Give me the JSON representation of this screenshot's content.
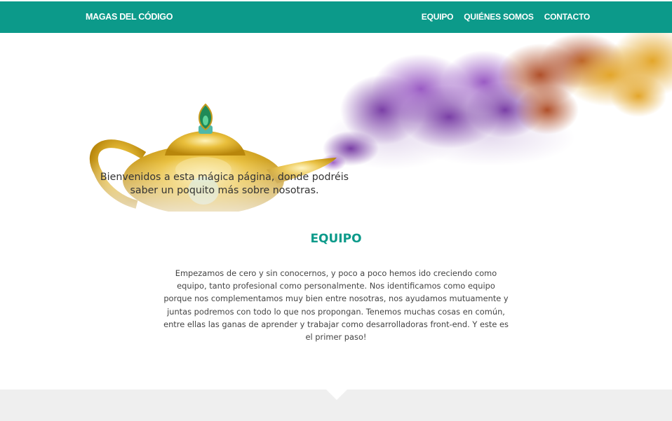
{
  "header": {
    "brand": "MAGAS DEL CÓDIGO",
    "nav": [
      {
        "label": "EQUIPO"
      },
      {
        "label": "QUIÉNES SOMOS"
      },
      {
        "label": "CONTACTO"
      }
    ]
  },
  "hero": {
    "tagline": "Bienvenidos a esta mágica página, donde podréis saber un poquito más sobre nosotras."
  },
  "team": {
    "title": "EQUIPO",
    "body": "Empezamos de cero y sin conocernos, y poco a poco hemos ido creciendo como equipo, tanto profesional como personalmente. Nos identificamos como equipo porque nos complementamos muy bien entre nosotras, nos ayudamos mutuamente y juntas podremos con todo lo que nos propongan. Tenemos muchas cosas en común, entre ellas las ganas de aprender y trabajar como desarrolladoras front-end. Y este es el primer paso!"
  },
  "colors": {
    "brand_teal": "#0c9a8a",
    "band_grey": "#efefef"
  }
}
